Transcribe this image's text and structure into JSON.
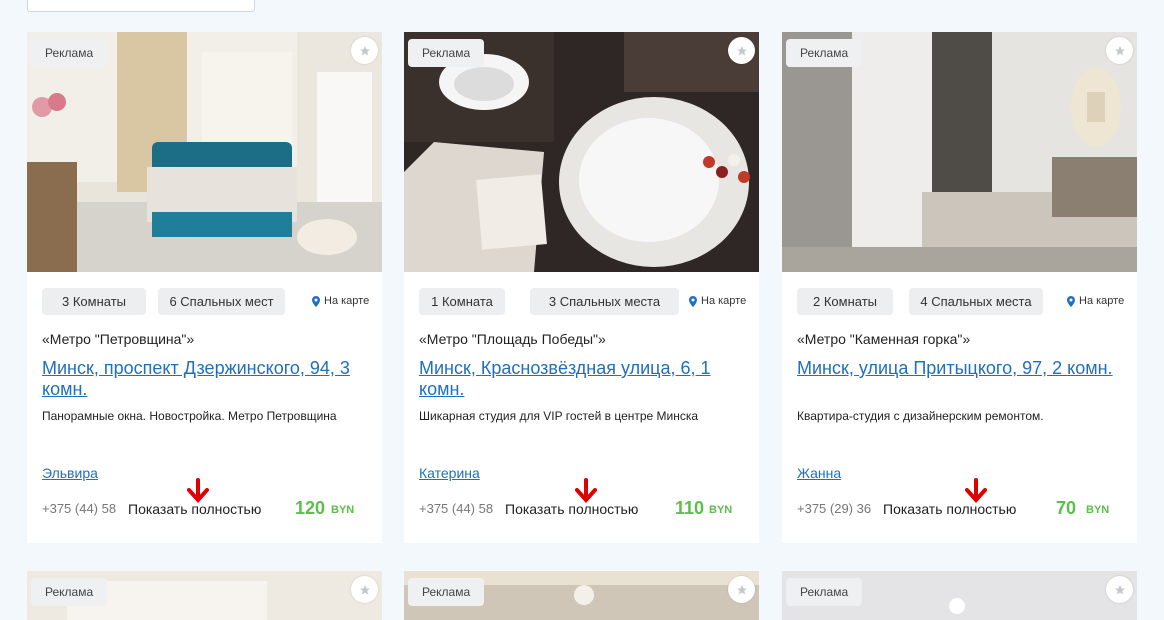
{
  "colors": {
    "accent_link": "#1f6fbf",
    "price": "#5bc04a",
    "arrow": "#e00000",
    "chip_bg": "#eceef0"
  },
  "cards": [
    {
      "ad_label": "Реклама",
      "rooms": "3 Комнаты",
      "beds": "6 Спальных мест",
      "map_label": "На карте",
      "metro": "«Метро \"Петровщина\"»",
      "title": "Минск, проспект Дзержинского, 94, 3 комн.",
      "description": "Панорамные окна. Новостройка. Метро Петровщина",
      "owner": "Эльвира",
      "phone": "+375 (44) 58",
      "show_full": "Показать полностью",
      "price": "120",
      "currency": "BYN",
      "photo_icon": "bedroom-photo"
    },
    {
      "ad_label": "Реклама",
      "rooms": "1 Комната",
      "beds": "3 Спальных места",
      "map_label": "На карте",
      "metro": "«Метро \"Площадь Победы\"»",
      "title": "Минск, Краснозвёздная улица, 6, 1 комн.",
      "description": "Шикарная студия для VIP гостей в центре Минска",
      "owner": "Катерина",
      "phone": "+375 (44) 58",
      "show_full": "Показать полностью",
      "price": "110",
      "currency": "BYN",
      "photo_icon": "bathroom-photo"
    },
    {
      "ad_label": "Реклама",
      "rooms": "2 Комнаты",
      "beds": "4 Спальных места",
      "map_label": "На карте",
      "metro": "«Метро \"Каменная горка\"»",
      "title": "Минск, улица Притыцкого, 97, 2 комн.",
      "description": "Квартира-студия  с дизайнерским ремонтом.",
      "owner": "Жанна",
      "phone": "+375 (29) 36",
      "show_full": "Показать полностью",
      "price": "70",
      "currency": "BYN",
      "photo_icon": "bedroom-photo"
    }
  ],
  "row2_cards": [
    {
      "ad_label": "Реклама"
    },
    {
      "ad_label": "Реклама"
    },
    {
      "ad_label": "Реклама"
    }
  ]
}
